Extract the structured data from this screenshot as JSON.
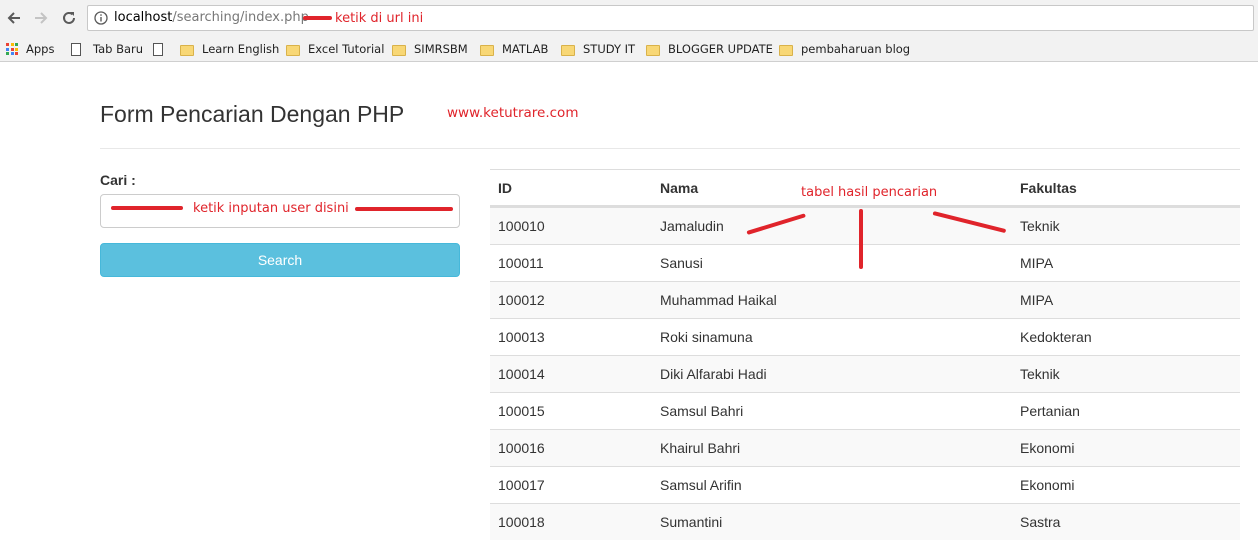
{
  "browser": {
    "url_host": "localhost",
    "url_path": "/searching/index.php",
    "bookmarks": [
      {
        "label": "Apps",
        "icon": "apps-grid-icon"
      },
      {
        "label": "Tab Baru",
        "icon": "page-icon"
      },
      {
        "label": "",
        "icon": "page-icon"
      },
      {
        "label": "Learn English",
        "icon": "folder-icon"
      },
      {
        "label": "Excel Tutorial",
        "icon": "folder-icon"
      },
      {
        "label": "SIMRSBM",
        "icon": "folder-icon"
      },
      {
        "label": "MATLAB",
        "icon": "folder-icon"
      },
      {
        "label": "STUDY IT",
        "icon": "folder-icon"
      },
      {
        "label": "BLOGGER UPDATE",
        "icon": "folder-icon"
      },
      {
        "label": "pembaharuan blog",
        "icon": "folder-icon"
      }
    ]
  },
  "page": {
    "title": "Form Pencarian Dengan PHP",
    "site": "www.ketutrare.com"
  },
  "search": {
    "label": "Cari :",
    "value": "",
    "button_label": "Search"
  },
  "table": {
    "headers": [
      "ID",
      "Nama",
      "Fakultas"
    ],
    "rows": [
      [
        "100010",
        "Jamaludin",
        "Teknik"
      ],
      [
        "100011",
        "Sanusi",
        "MIPA"
      ],
      [
        "100012",
        "Muhammad Haikal",
        "MIPA"
      ],
      [
        "100013",
        "Roki sinamuna",
        "Kedokteran"
      ],
      [
        "100014",
        "Diki Alfarabi Hadi",
        "Teknik"
      ],
      [
        "100015",
        "Samsul Bahri",
        "Pertanian"
      ],
      [
        "100016",
        "Khairul Bahri",
        "Ekonomi"
      ],
      [
        "100017",
        "Samsul Arifin",
        "Ekonomi"
      ],
      [
        "100018",
        "Sumantini",
        "Sastra"
      ]
    ]
  },
  "annotations": {
    "url_note": "ketik di url ini",
    "input_note": "ketik inputan user disini",
    "table_note": "tabel hasil pencarian",
    "color": "#e0242b"
  }
}
